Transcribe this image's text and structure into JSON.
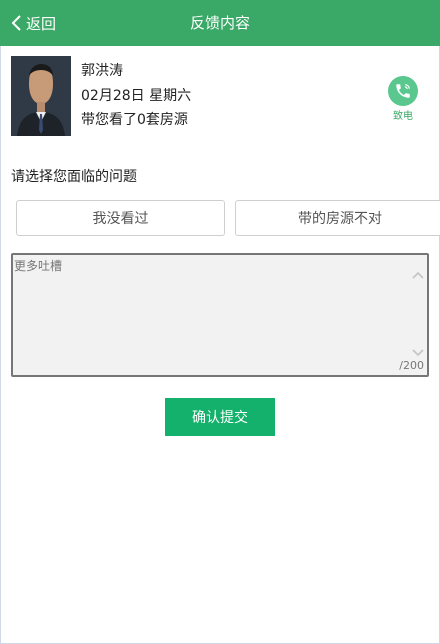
{
  "header": {
    "back_label": "返回",
    "title": "反馈内容",
    "bg_color": "#3aa866"
  },
  "agent": {
    "name": "郭洪涛",
    "date": "02月28日 星期六",
    "viewed_text": "带您看了0套房源",
    "call_label": "致电"
  },
  "question": {
    "prompt": "请选择您面临的问题",
    "options": [
      "我没看过",
      "带的房源不对"
    ]
  },
  "feedback": {
    "placeholder": "更多吐槽",
    "value": "",
    "counter": "/200"
  },
  "submit": {
    "label": "确认提交",
    "color": "#13b16b"
  }
}
